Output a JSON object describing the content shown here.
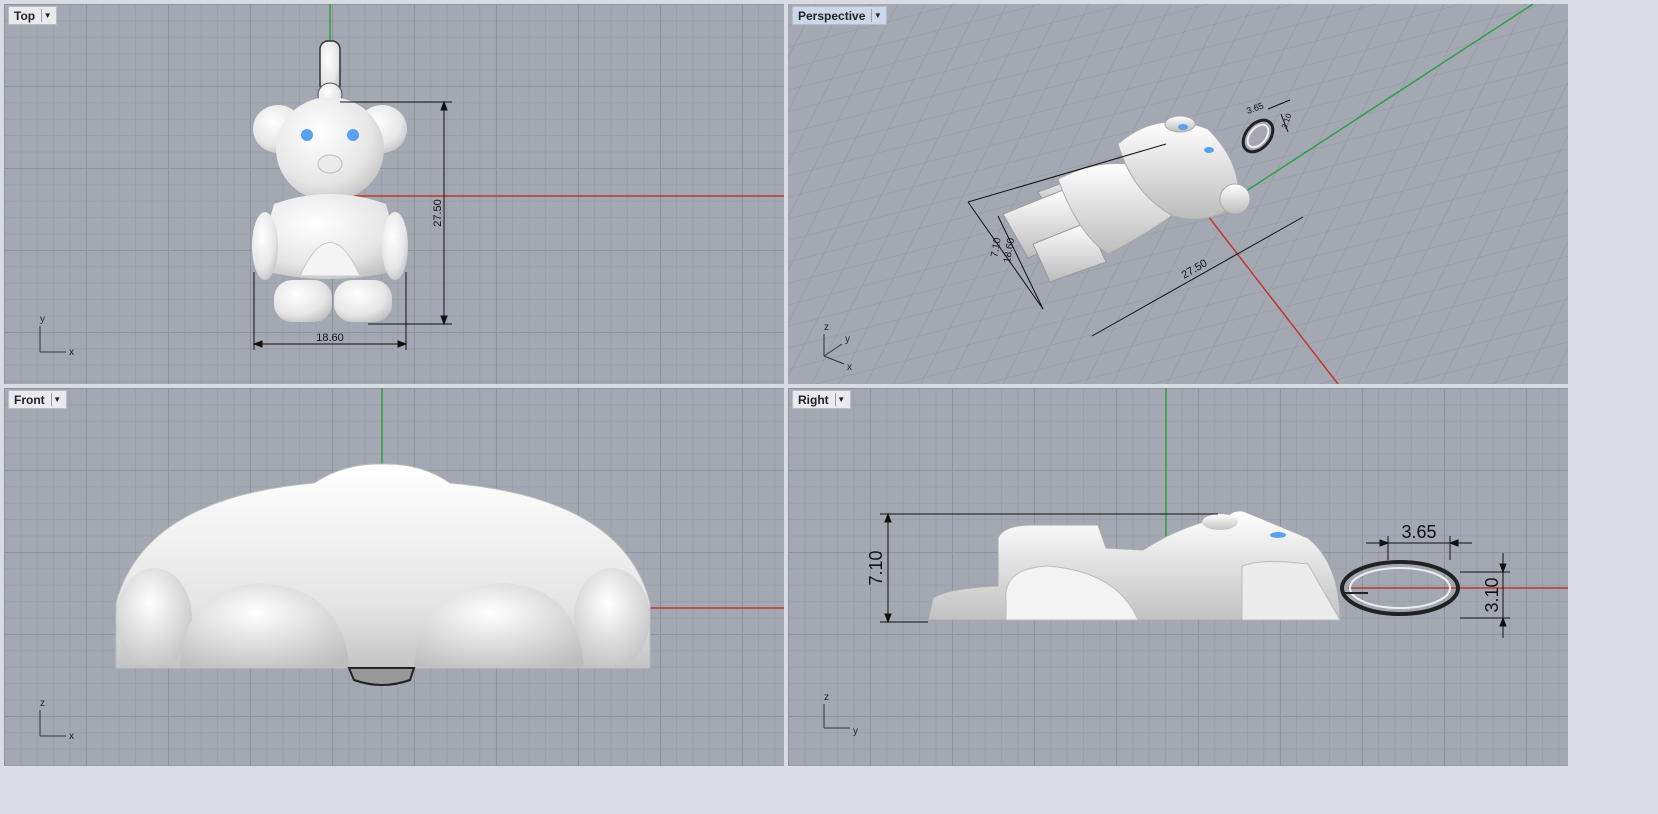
{
  "viewports": {
    "top": {
      "label": "Top",
      "dims": {
        "height": "27.50",
        "width": "18.60"
      },
      "axes": {
        "a": "y",
        "b": "x"
      }
    },
    "perspective": {
      "label": "Perspective",
      "dims": {
        "length": "27.50",
        "width": "18.60",
        "thickness": "7.10",
        "bail_w": "3.65",
        "bail_h": "3.10"
      },
      "axes": {
        "a": "z",
        "b": "y",
        "c": "x"
      }
    },
    "front": {
      "label": "Front",
      "axes": {
        "a": "z",
        "b": "x"
      }
    },
    "right": {
      "label": "Right",
      "dims": {
        "thickness": "7.10",
        "bail_w": "3.65",
        "bail_h": "3.10"
      },
      "axes": {
        "a": "z",
        "b": "y"
      }
    }
  },
  "colors": {
    "x_axis": "#c0392b",
    "y_axis": "#2ea043",
    "model": "#eeeeee",
    "eyes": "#5aa0f0"
  },
  "icons": {
    "dropdown": "chevron-down-icon"
  }
}
